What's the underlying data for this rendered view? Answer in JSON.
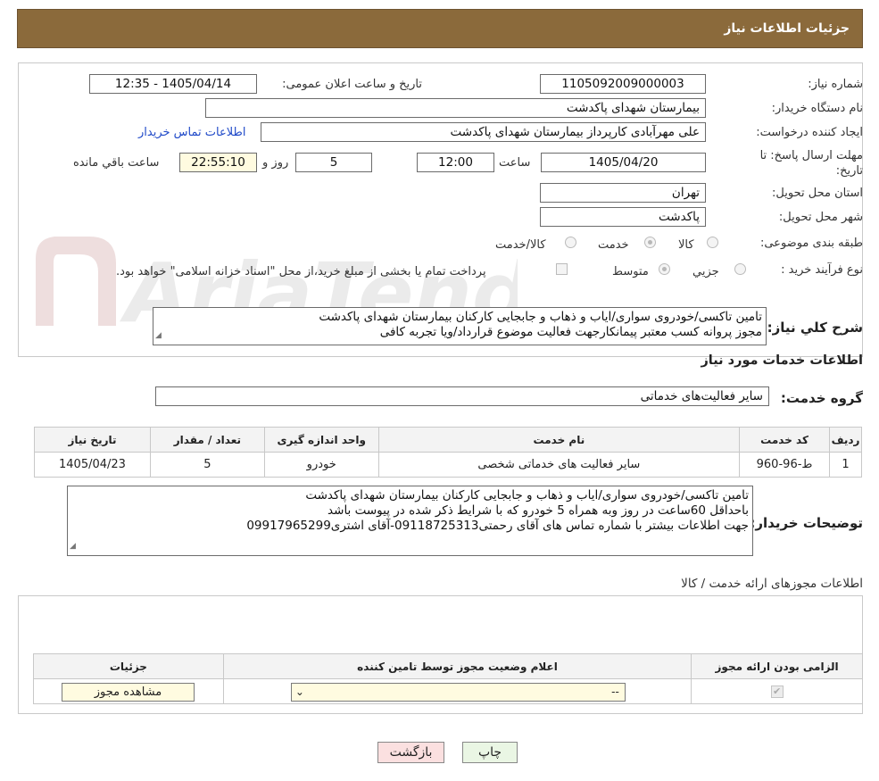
{
  "header": {
    "title": "جزئیات اطلاعات نیاز"
  },
  "form": {
    "need_number": {
      "label": "شماره نیاز:",
      "value": "1105092009000003"
    },
    "announce_datetime": {
      "label": "تاریخ و ساعت اعلان عمومی:",
      "value": "1405/04/14 - 12:35"
    },
    "buyer_org": {
      "label": "نام دستگاه خریدار:",
      "value": "بیمارستان شهدای پاکدشت"
    },
    "creator": {
      "label": "ایجاد کننده درخواست:",
      "value": "علی مهرآبادی کارپرداز بیمارستان شهدای پاکدشت",
      "contact_link": "اطلاعات تماس خریدار"
    },
    "deadline": {
      "label": "مهلت ارسال پاسخ: تا تاریخ:",
      "date": "1405/04/20",
      "time_label": "ساعت",
      "time": "12:00",
      "days": "5",
      "days_label": "روز و",
      "remaining": "22:55:10",
      "remaining_label": "ساعت باقي مانده"
    },
    "province": {
      "label": "استان محل تحویل:",
      "value": "تهران"
    },
    "city": {
      "label": "شهر محل تحویل:",
      "value": "پاکدشت"
    },
    "category": {
      "label": "طبقه بندی موضوعی:",
      "options": [
        "کالا",
        "خدمت",
        "کالا/خدمت"
      ],
      "selected": "خدمت"
    },
    "purchase_type": {
      "label": "نوع فرآیند خرید :",
      "options": [
        "جزیي",
        "متوسط"
      ],
      "selected": "متوسط",
      "payment_note": "پرداخت تمام یا بخشی از مبلغ خرید،از محل \"اسناد خزانه اسلامی\" خواهد بود."
    },
    "description": {
      "label": "شرح کلي نیاز:",
      "lines": [
        "تامین تاکسی/خودروی سواری/ایاب و ذهاب و جابجایی کارکنان بیمارستان شهدای پاکدشت",
        "مجوز پروانه کسب معتبر پیمانکارجهت فعالیت موضوع قرارداد/ویا تجربه کافی"
      ]
    }
  },
  "services": {
    "section_title": "اطلاعات خدمات مورد نیاز",
    "group_label": "گروه خدمت:",
    "group_value": "سایر فعالیت‌های خدماتی",
    "table": {
      "headers": [
        "ردیف",
        "کد خدمت",
        "نام خدمت",
        "واحد اندازه گیری",
        "تعداد / مقدار",
        "تاریخ نیاز"
      ],
      "rows": [
        [
          "1",
          "ط-96-960",
          "سایر فعالیت های خدماتی شخصی",
          "خودرو",
          "5",
          "1405/04/23"
        ]
      ]
    },
    "buyer_notes": {
      "label": "توضیحات خریدار:",
      "lines": [
        "تامین تاکسی/خودروی سواری/ایاب و ذهاب و جابجایی کارکنان بیمارستان شهدای پاکدشت",
        "باحداقل 60ساعت در روز وبه همراه 5 خودرو که با شرایط ذکر شده در پیوست باشد",
        "جهت اطلاعات بیشتر با شماره تماس های آقای رحمتی09118725313-آقای اشتری09917965299"
      ]
    }
  },
  "permits": {
    "section_title": "اطلاعات مجوزهای ارائه خدمت / کالا",
    "headers": [
      "الزامی بودن ارائه مجوز",
      "اعلام وضعیت مجوز توسط تامین کننده",
      "جزئیات"
    ],
    "row": {
      "select_value": "--",
      "view_button": "مشاهده مجوز"
    }
  },
  "actions": {
    "print": "چاپ",
    "back": "بازگشت"
  },
  "watermark": "AriaTender.neT",
  "colors": {
    "header_bg": "#8b6a3b",
    "link": "#1f49c8",
    "back_btn": "#fbe0e0",
    "print_btn": "#eaf6e4"
  }
}
